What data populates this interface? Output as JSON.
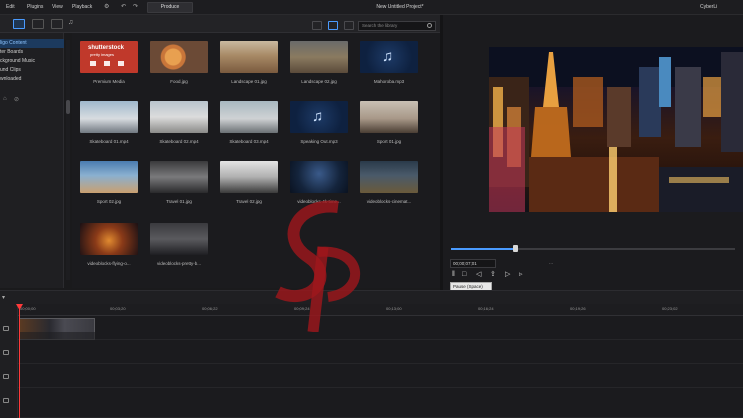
{
  "menubar": {
    "items": [
      "Edit",
      "Plugins",
      "View",
      "Playback"
    ],
    "produce_label": "Produce",
    "project_title": "New Untitled Project*",
    "brand": "CyberLi"
  },
  "library": {
    "search_placeholder": "Search the library",
    "sidebar_items": [
      "ligo Content",
      "ter Boards",
      "ckground Music",
      "und Clips",
      "wnloaded"
    ],
    "tiles": [
      {
        "label": "Premium Media"
      },
      {
        "label": "Food.jpg"
      },
      {
        "label": "Landscape 01.jpg"
      },
      {
        "label": "Landscape 02.jpg"
      },
      {
        "label": "Mahoroba.mp3"
      },
      {
        "label": "Skateboard 01.mp4"
      },
      {
        "label": "Skateboard 02.mp4"
      },
      {
        "label": "Skateboard 03.mp4"
      },
      {
        "label": "Speaking Out.mp3"
      },
      {
        "label": "Sport 01.jpg"
      },
      {
        "label": "Sport 02.jpg"
      },
      {
        "label": "Travel 01.jpg"
      },
      {
        "label": "Travel 02.jpg"
      },
      {
        "label": "videoblocks-4k-time..."
      },
      {
        "label": "videoblocks-cinemat..."
      },
      {
        "label": "videoblocks-flying-o..."
      },
      {
        "label": "videoblocks-pretty-b..."
      }
    ],
    "premium_logo_text": "shutterstock",
    "premium_logo_sub": "pretty images"
  },
  "preview": {
    "timecode": "00;00;07;01",
    "tooltip": "Pause (Space)",
    "quality": "..."
  },
  "timeline": {
    "ruler": [
      "00;00;00",
      "00;03;20",
      "00;06;22",
      "00;09;24",
      "00;13;00",
      "00;16;24",
      "00;19;26",
      "00;23;02",
      "00;26;04"
    ]
  },
  "colors": {
    "accent": "#4a9bff",
    "playhead": "#ff3a3a",
    "premium_bg": "#c0392b"
  }
}
